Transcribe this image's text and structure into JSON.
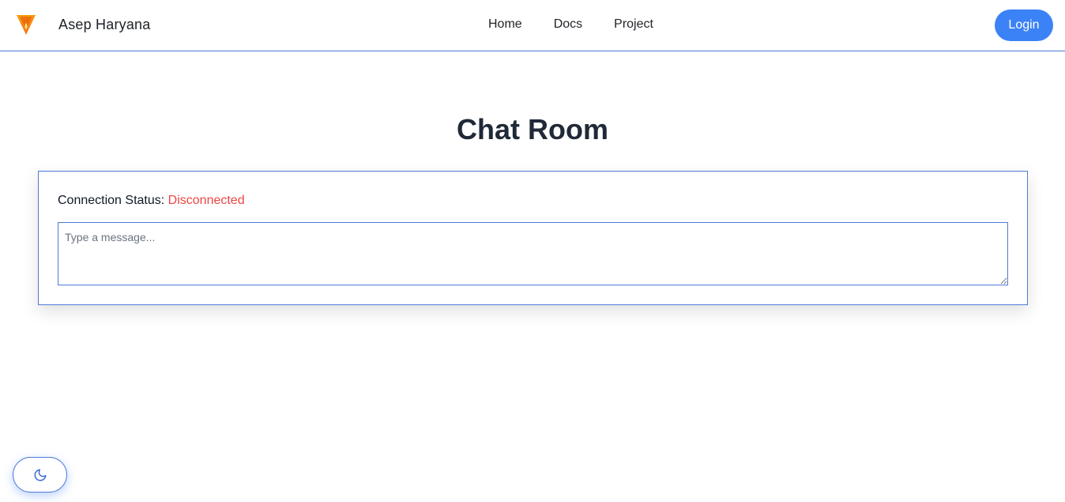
{
  "header": {
    "brand_name": "Asep Haryana",
    "logo_icon": "flame-triangle-logo",
    "nav": [
      {
        "label": "Home"
      },
      {
        "label": "Docs"
      },
      {
        "label": "Project"
      }
    ],
    "login_label": "Login"
  },
  "main": {
    "title": "Chat Room",
    "status_label": "Connection Status:",
    "status_value": "Disconnected",
    "message_placeholder": "Type a message..."
  },
  "theme_toggle": {
    "icon": "moon-icon"
  },
  "colors": {
    "accent": "#3b82f6",
    "border": "#4f7bd9",
    "status_disconnected": "#ef4444",
    "title_text": "#1f2937"
  }
}
